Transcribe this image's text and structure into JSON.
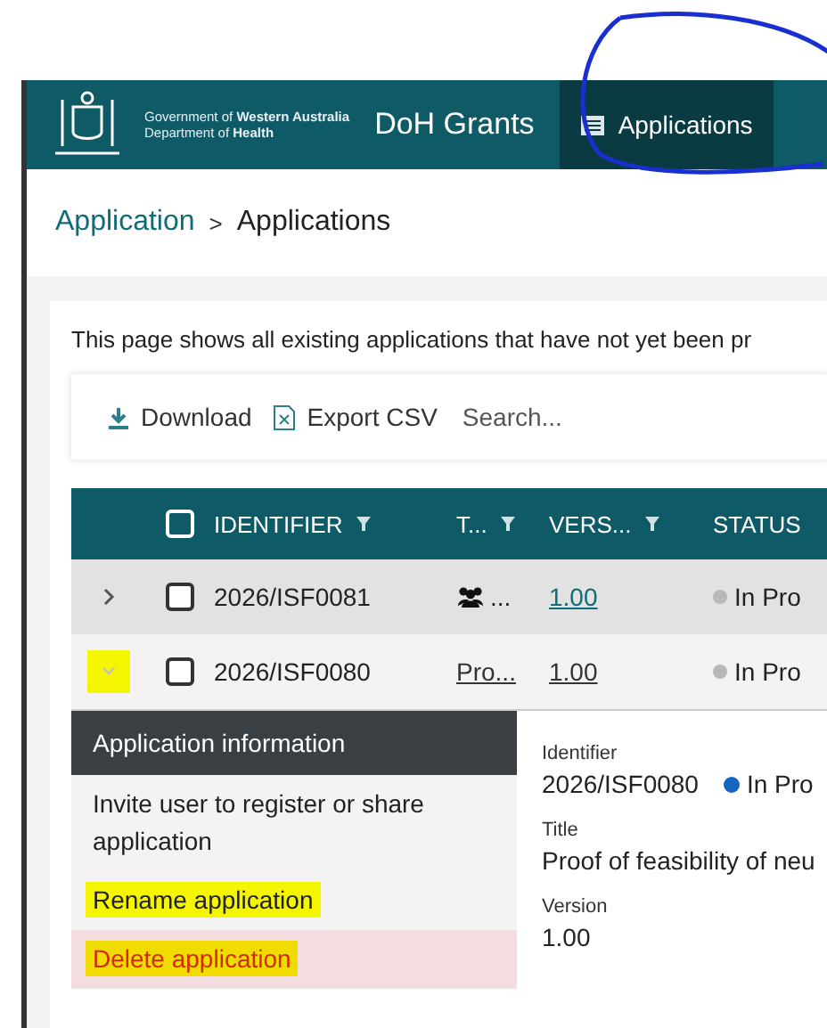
{
  "header": {
    "org_line_1": "Government of **Western Australia**",
    "org_line_2": "Department of **Health**",
    "app_name": "DoH Grants",
    "nav": [
      {
        "label": "Applications",
        "selected": true,
        "circled": true
      }
    ]
  },
  "breadcrumb": [
    "Application",
    "Applications"
  ],
  "breadcrumb_separator": ">",
  "description": "This page shows all existing applications that have not yet been pr",
  "toolbar": {
    "buttons": [
      {
        "label": "Download",
        "kind": "download"
      },
      {
        "label": "Export CSV",
        "kind": "excel"
      }
    ],
    "search": {
      "placeholder": "Search..."
    }
  },
  "table": {
    "select_all": {
      "checked": false
    },
    "columns": [
      {
        "label": "IDENTIFIER",
        "filter": true
      },
      {
        "label": "T...",
        "filter": true
      },
      {
        "label": "VERS...",
        "filter": true
      },
      {
        "label": "STATUS",
        "filter": false
      }
    ],
    "rows": [
      {
        "expanded": false,
        "highlighted": false,
        "checked": false,
        "identifier": "2026/ISF0081",
        "title": "...",
        "title_icon": true,
        "version": "1.00",
        "status": "In Pro"
      },
      {
        "expanded": true,
        "highlighted": true,
        "checked": false,
        "identifier": "2026/ISF0080",
        "title": "Pro...",
        "title_icon": false,
        "version": "1.00",
        "status": "In Pro"
      }
    ]
  },
  "details": {
    "menu_title": "Application information",
    "menu": [
      {
        "label": "Invite user to register or share application",
        "kind": "normal",
        "highlighted": false
      },
      {
        "label": "Rename application",
        "kind": "normal",
        "highlighted": true
      },
      {
        "label": "Delete application",
        "kind": "danger",
        "highlighted": true
      }
    ],
    "fields": [
      {
        "label": "Identifier",
        "value": "2026/ISF0080",
        "status": "In Pro",
        "color": "#1565c0"
      },
      {
        "label": "Title",
        "value": "Proof of feasibility of neu"
      },
      {
        "label": "Version",
        "value": "1.00"
      }
    ]
  }
}
